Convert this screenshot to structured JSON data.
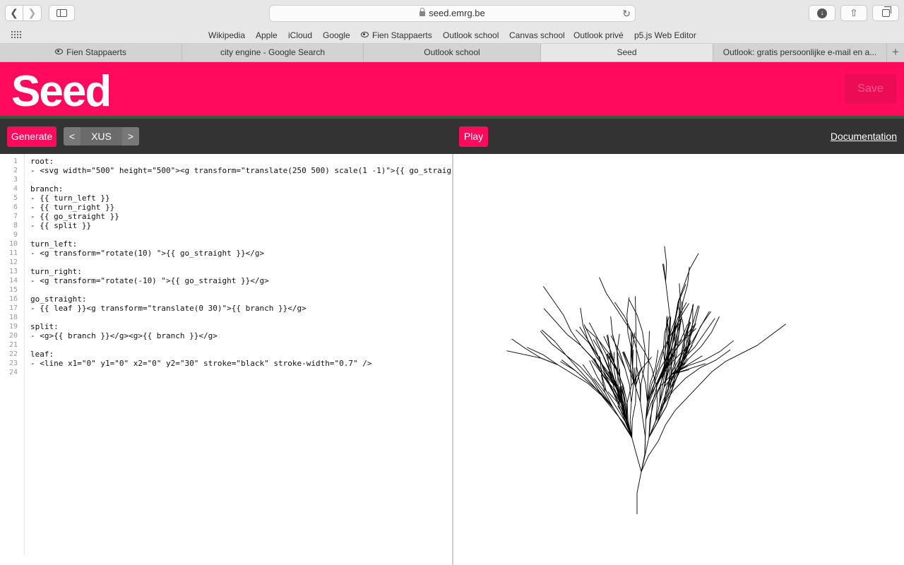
{
  "browser": {
    "url": "seed.emrg.be",
    "favorites": [
      {
        "label": "Wikipedia"
      },
      {
        "label": "Apple"
      },
      {
        "label": "iCloud"
      },
      {
        "label": "Google"
      },
      {
        "label": "Fien Stappaerts",
        "icon": "eye-icon"
      },
      {
        "label": "Outlook school"
      },
      {
        "label": "Canvas school"
      },
      {
        "label": "Outlook privé"
      },
      {
        "label": "p5.js Web Editor"
      }
    ],
    "tabs": [
      {
        "label": "Fien Stappaerts",
        "icon": "eye-icon"
      },
      {
        "label": "city engine - Google Search"
      },
      {
        "label": "Outlook school"
      },
      {
        "label": "Seed",
        "active": true
      },
      {
        "label": "Outlook: gratis persoonlijke e-mail en a..."
      }
    ]
  },
  "app": {
    "title": "Seed",
    "save_label": "Save",
    "generate_label": "Generate",
    "seed_prev": "<",
    "seed_value": "XUS",
    "seed_next": ">",
    "play_label": "Play",
    "documentation_label": "Documentation",
    "accent_color": "#ff0a5c"
  },
  "editor": {
    "lines": [
      "root:",
      "- <svg width=\"500\" height=\"500\"><g transform=\"translate(250 500) scale(1 -1)\">{{ go_straig",
      "",
      "branch:",
      "- {{ turn_left }}",
      "- {{ turn_right }}",
      "- {{ go_straight }}",
      "- {{ split }}",
      "",
      "turn_left:",
      "- <g transform=\"rotate(10) \">{{ go_straight }}</g>",
      "",
      "turn_right:",
      "- <g transform=\"rotate(-10) \">{{ go_straight }}</g>",
      "",
      "go_straight:",
      "- {{ leaf }}<g transform=\"translate(0 30)\">{{ branch }}</g>",
      "",
      "split:",
      "- <g>{{ branch }}</g><g>{{ branch }}</g>",
      "",
      "leaf:",
      "- <line x1=\"0\" y1=\"0\" x2=\"0\" y2=\"30\" stroke=\"black\" stroke-width=\"0.7\" />",
      ""
    ]
  }
}
